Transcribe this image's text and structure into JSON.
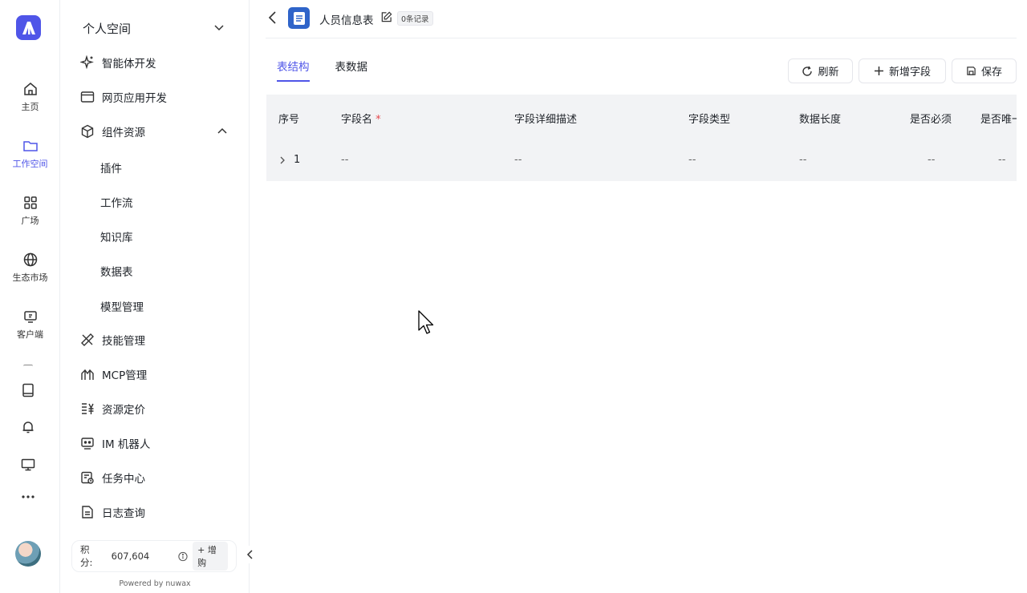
{
  "rail": {
    "items": [
      {
        "label": "主页",
        "icon": "home-icon"
      },
      {
        "label": "工作空间",
        "icon": "folder-icon",
        "active": true
      },
      {
        "label": "广场",
        "icon": "grid-icon"
      },
      {
        "label": "生态市场",
        "icon": "globe-icon"
      },
      {
        "label": "客户端",
        "icon": "client-icon"
      }
    ],
    "bottom_icons": [
      "book-icon",
      "bell-icon",
      "monitor-icon",
      "more-icon"
    ]
  },
  "panel": {
    "title": "个人空间",
    "menu": [
      {
        "label": "智能体开发",
        "icon": "sparkle-icon"
      },
      {
        "label": "网页应用开发",
        "icon": "browser-icon"
      },
      {
        "label": "组件资源",
        "icon": "cube-icon",
        "expanded": true
      }
    ],
    "submenu": [
      "插件",
      "工作流",
      "知识库",
      "数据表",
      "模型管理"
    ],
    "menu2": [
      {
        "label": "技能管理",
        "icon": "tools-icon"
      },
      {
        "label": "MCP管理",
        "icon": "mcp-icon"
      },
      {
        "label": "资源定价",
        "icon": "pricing-icon"
      },
      {
        "label": "IM 机器人",
        "icon": "robot-icon"
      },
      {
        "label": "任务中心",
        "icon": "task-icon"
      },
      {
        "label": "日志查询",
        "icon": "log-icon"
      }
    ],
    "points_label": "积分:",
    "points_value": "607,604",
    "buy_label": "+ 增购",
    "powered": "Powered by nuwax"
  },
  "header": {
    "title": "人员信息表",
    "record_badge": "0条记录"
  },
  "tabs": [
    "表结构",
    "表数据"
  ],
  "toolbar": {
    "refresh": "刷新",
    "add_field": "新增字段",
    "save": "保存"
  },
  "table": {
    "columns": [
      "序号",
      "字段名",
      "字段详细描述",
      "字段类型",
      "数据长度",
      "是否必须",
      "是否唯一"
    ],
    "required_mark": "*",
    "rows": [
      {
        "index": "1",
        "name": "--",
        "desc": "--",
        "type": "--",
        "length": "--",
        "required": "--",
        "unique": "--"
      }
    ]
  },
  "colors": {
    "accent": "#4f55e8",
    "table_bg": "#f2f3f5",
    "doc_icon": "#2f64c9"
  }
}
